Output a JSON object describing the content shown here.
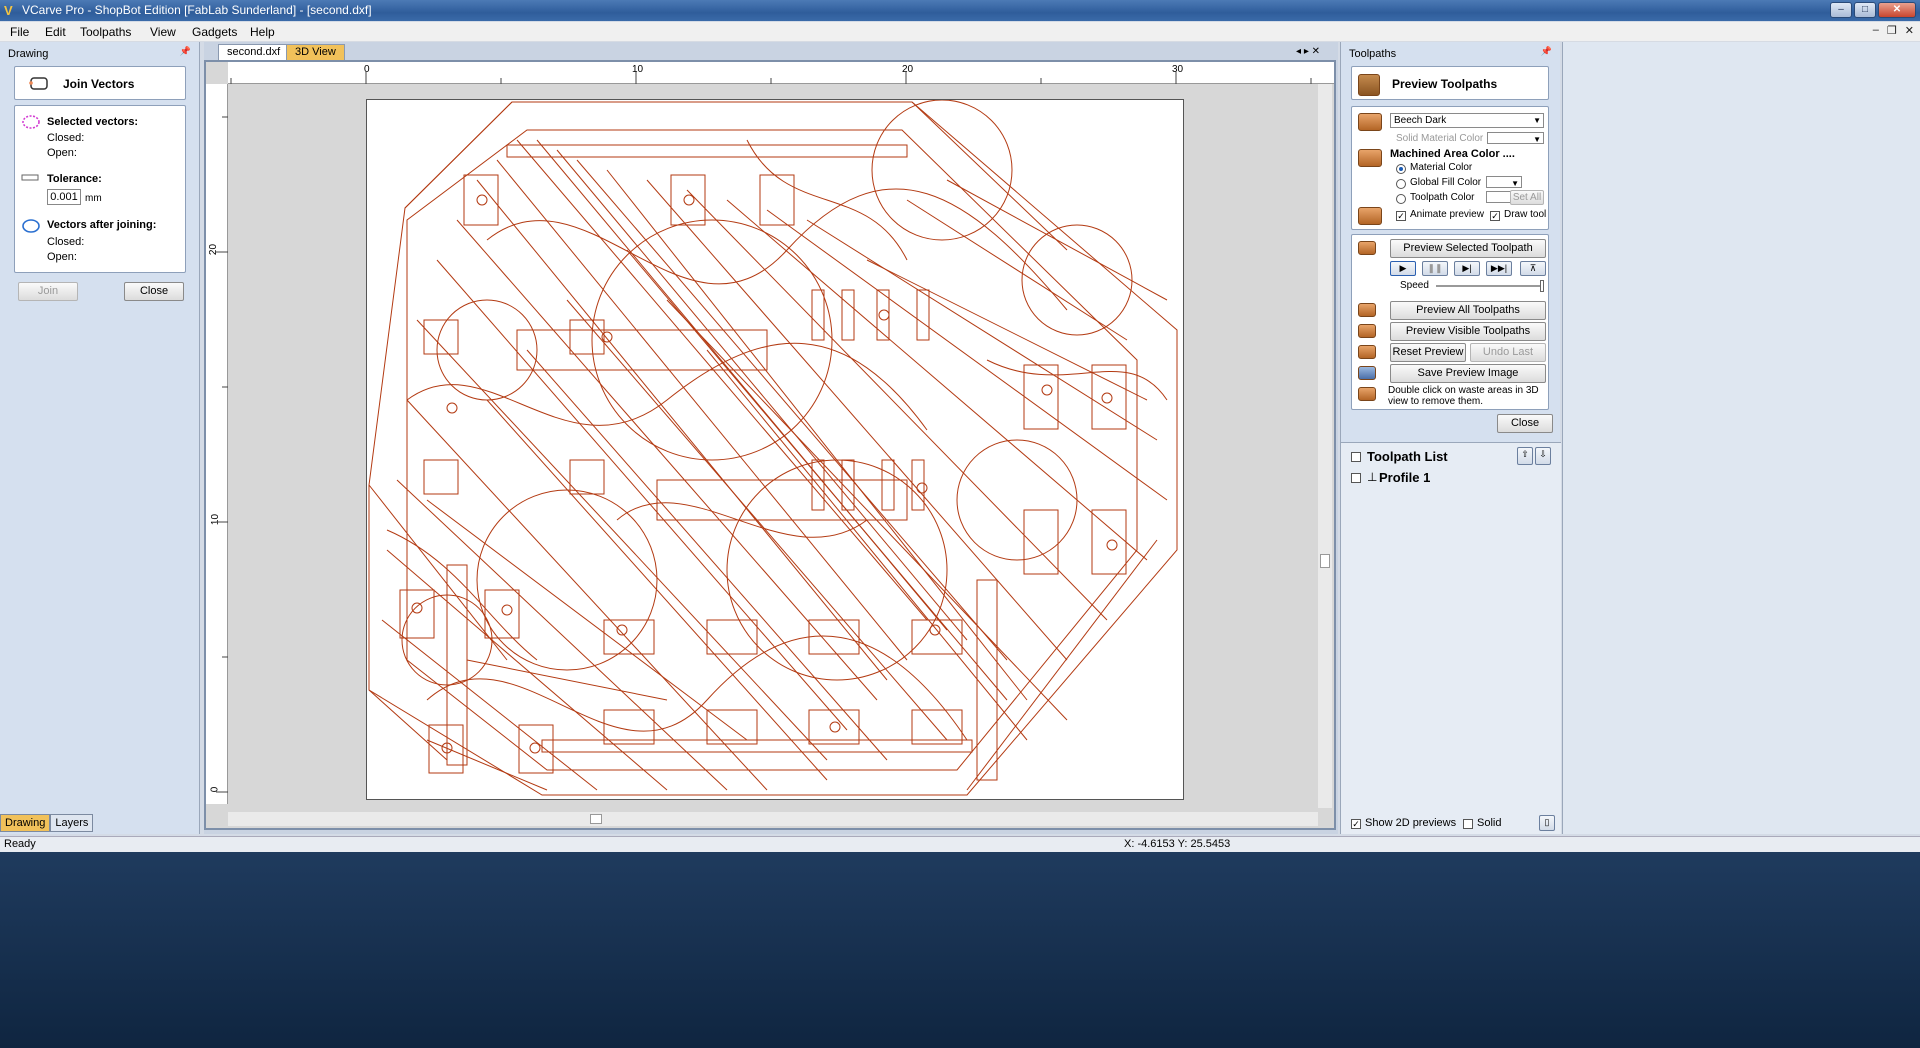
{
  "window": {
    "title": "VCarve Pro - ShopBot Edition [FabLab Sunderland] - [second.dxf]",
    "controls": [
      "–",
      "□",
      "✕"
    ]
  },
  "menu": {
    "items": [
      "File",
      "Edit",
      "Toolpaths",
      "View",
      "Gadgets",
      "Help"
    ],
    "mdi": [
      "–",
      "❐",
      "✕"
    ]
  },
  "left_panel": {
    "title": "Drawing",
    "tool_title": "Join Vectors",
    "selected_heading": "Selected vectors:",
    "closed_label": "Closed:",
    "open_label": "Open:",
    "tolerance_heading": "Tolerance:",
    "tolerance_value": "0.001",
    "tolerance_unit": "mm",
    "after_heading": "Vectors after joining:",
    "after_closed_label": "Closed:",
    "after_open_label": "Open:",
    "join_button": "Join",
    "close_button": "Close",
    "bottom_tabs": [
      "Drawing",
      "Layers"
    ]
  },
  "doc": {
    "tabs": [
      "second.dxf",
      "3D View"
    ],
    "h_ruler": [
      "0",
      "10",
      "20",
      "30"
    ],
    "v_ruler": [
      "20",
      "10",
      "0"
    ]
  },
  "right_panel": {
    "title": "Toolpaths",
    "tool_title": "Preview Toolpaths",
    "material": "Beech Dark",
    "solid_material_color_label": "Solid Material Color",
    "machined_area_heading": "Machined Area Color ....",
    "material_color": "Material Color",
    "global_fill_color": "Global Fill Color",
    "toolpath_color": "Toolpath Color",
    "set_all": "Set All",
    "animate_preview": "Animate preview",
    "draw_tool": "Draw tool",
    "preview_selected": "Preview Selected Toolpath",
    "speed_label": "Speed",
    "preview_all": "Preview All Toolpaths",
    "preview_visible": "Preview Visible Toolpaths",
    "reset_preview": "Reset Preview",
    "undo_last": "Undo Last",
    "save_preview_image": "Save Preview Image",
    "hint": "Double click on waste areas in 3D view to remove them.",
    "close_button": "Close",
    "toolpath_list_label": "Toolpath List",
    "toolpaths": [
      "Profile 1"
    ],
    "show_2d_previews": "Show 2D previews",
    "solid_label": "Solid",
    "colors": {
      "accent": "#f1c15a",
      "vector_stroke": "#b33a12"
    }
  },
  "status": {
    "left": "Ready",
    "coords": "X: -4.6153 Y: 25.5453"
  }
}
